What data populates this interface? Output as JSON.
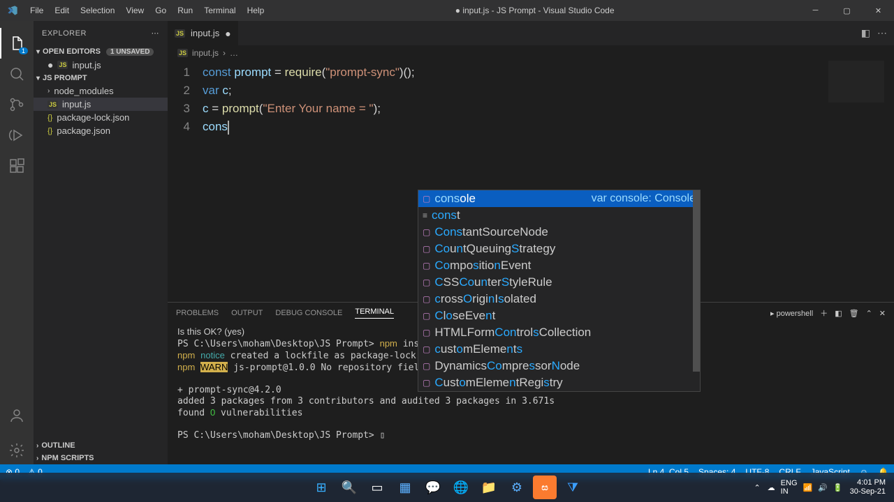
{
  "titlebar": {
    "menu": [
      "File",
      "Edit",
      "Selection",
      "View",
      "Go",
      "Run",
      "Terminal",
      "Help"
    ],
    "title": "● input.js - JS Prompt - Visual Studio Code"
  },
  "activitybar": {
    "badge": "1"
  },
  "sidebar": {
    "header": "EXPLORER",
    "open_editors_label": "OPEN EDITORS",
    "unsaved_badge": "1 UNSAVED",
    "project_label": "JS PROMPT",
    "outline_label": "OUTLINE",
    "npm_label": "NPM SCRIPTS",
    "files": {
      "open_editor": "input.js",
      "node_modules": "node_modules",
      "input": "input.js",
      "pkglock": "package-lock.json",
      "pkg": "package.json"
    }
  },
  "tab": {
    "name": "input.js"
  },
  "breadcrumb": {
    "file": "input.js",
    "sep": "›",
    "more": "…"
  },
  "code": {
    "gutter": [
      "1",
      "2",
      "3",
      "4"
    ],
    "l1": {
      "kw": "const",
      "v": "prompt",
      "eq": " = ",
      "fn": "require",
      "p1": "(",
      "s": "\"prompt-sync\"",
      "p2": ")();"
    },
    "l2": {
      "kw": "var",
      "v": "c",
      "p": ";"
    },
    "l3": {
      "v": "c",
      "eq": " = ",
      "fn": "prompt",
      "p1": "(",
      "s": "\"Enter Your name = \"",
      "p2": ");"
    },
    "l4": {
      "txt": "cons"
    }
  },
  "suggest": {
    "detail": "var console: Console",
    "items": [
      {
        "pre": "cons",
        "match": "ole"
      },
      {
        "pre": "cons",
        "match": "t"
      },
      {
        "pre": "Cons",
        "match": "tantSourceNode"
      },
      {
        "pre": "Co",
        "mid": "untQueuing",
        "m2": "S",
        "rest": "trategy"
      },
      {
        "pre": "Co",
        "mid": "mpo",
        "m2": "s",
        "mid2": "itio",
        "m3": "n",
        "rest": "Event"
      },
      {
        "pre": "C",
        "mid": "SS",
        "m2": "Co",
        "mid2": "u",
        "m3": "n",
        "mid3": "ter",
        "m4": "S",
        "rest": "tyleRule"
      },
      {
        "pre": "c",
        "mid": "ross",
        "m2": "O",
        "mid2": "rigi",
        "m3": "n",
        "mid3": "I",
        "m4": "s",
        "rest": "olated"
      },
      {
        "pre": "C",
        "mid": "l",
        "m2": "o",
        "mid2": "seEve",
        "m3": "n",
        "rest": "t"
      },
      {
        "label": "HTMLFormControlsCollection"
      },
      {
        "pre": "c",
        "mid": "ust",
        "m2": "o",
        "mid2": "mEleme",
        "m3": "n",
        "mid3": "t",
        "m4": "s",
        "rest": ""
      },
      {
        "label": "DynamicsCompressorNode"
      },
      {
        "pre": "C",
        "mid": "ust",
        "m2": "o",
        "mid2": "mEleme",
        "m3": "n",
        "mid3": "tRegi",
        "m4": "s",
        "rest": "try"
      }
    ]
  },
  "panel": {
    "tabs": [
      "PROBLEMS",
      "OUTPUT",
      "DEBUG CONSOLE",
      "TERMINAL"
    ],
    "shell": "powershell",
    "body_line1": "Is this OK? (yes)",
    "body_line2": "PS C:\\Users\\moham\\Desktop\\JS Prompt> npm install prompt-sync",
    "body_line3": "npm notice created a lockfile as package-lock.json. You should commit this file.",
    "body_line4": "npm WARN js-prompt@1.0.0 No repository field.",
    "body_line5": "",
    "body_line6": "+ prompt-sync@4.2.0",
    "body_line7": "added 3 packages from 3 contributors and audited 3 packages in 3.671s",
    "body_line8": "found 0 vulnerabilities",
    "body_line9": "",
    "body_line10": "PS C:\\Users\\moham\\Desktop\\JS Prompt> ▯"
  },
  "status": {
    "errors": "⊗ 0",
    "warnings": "⚠ 0",
    "pos": "Ln 4, Col 5",
    "spaces": "Spaces: 4",
    "enc": "UTF-8",
    "eol": "CRLF",
    "lang": "JavaScript",
    "feedback": "☺",
    "bell": "🔔"
  },
  "taskbar": {
    "lang": "ENG",
    "kbd": "IN",
    "time": "4:01 PM",
    "date": "30-Sep-21"
  }
}
